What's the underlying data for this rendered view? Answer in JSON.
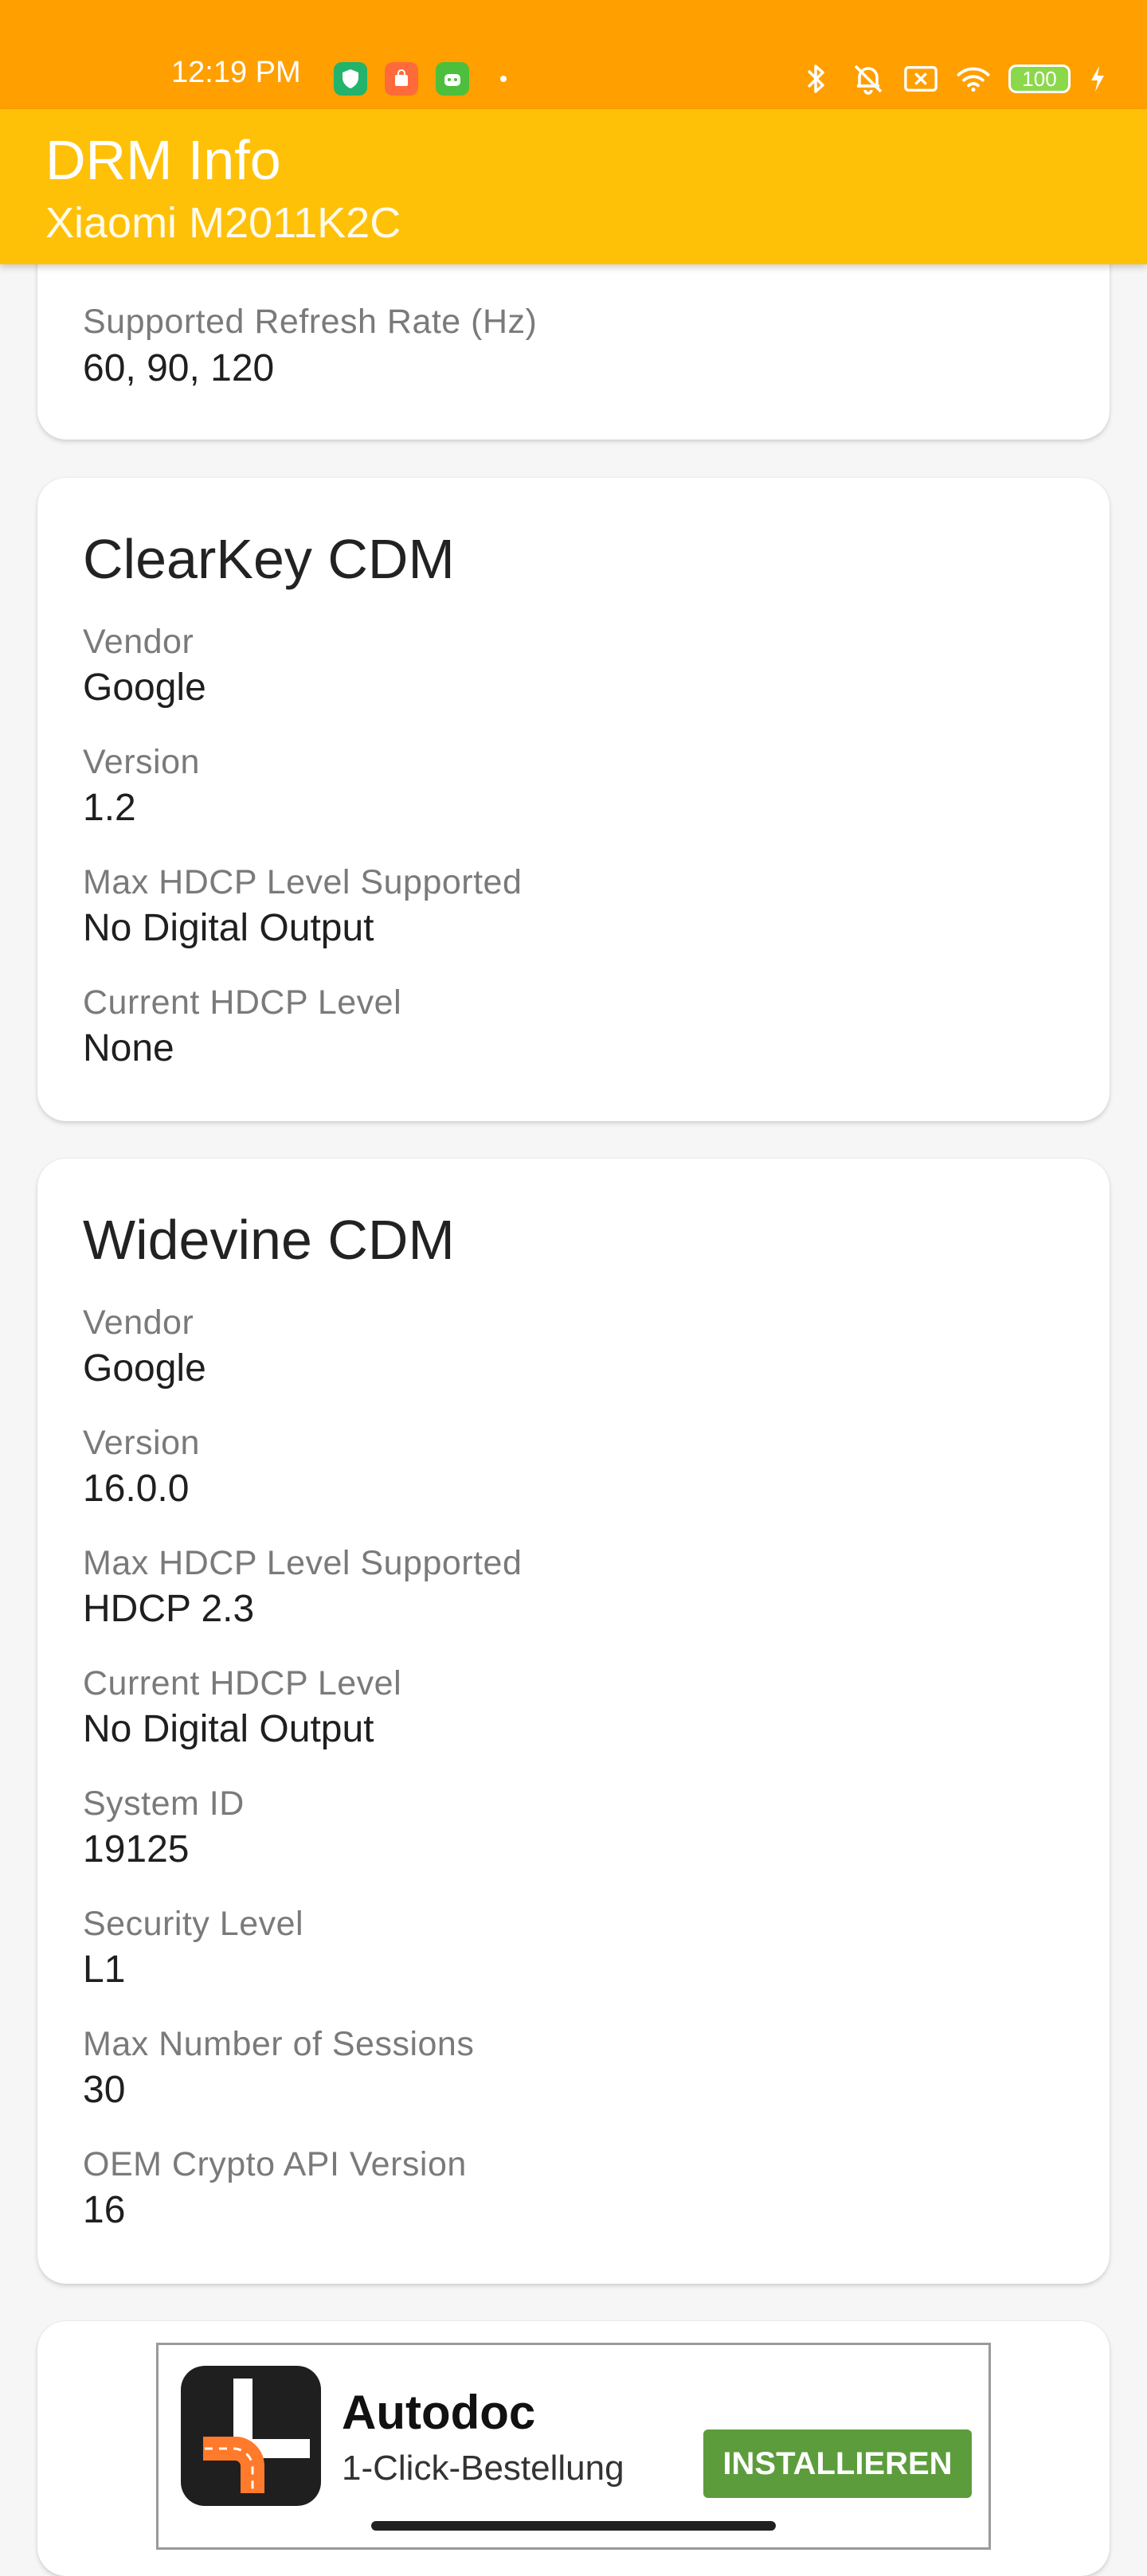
{
  "status_bar": {
    "time": "12:19 PM",
    "battery": "100"
  },
  "app_bar": {
    "title": "DRM Info",
    "subtitle": "Xiaomi M2011K2C"
  },
  "display_card": {
    "fields": [
      {
        "label": "Supported Refresh Rate (Hz)",
        "value": "60, 90, 120"
      }
    ]
  },
  "clearkey_card": {
    "title": "ClearKey CDM",
    "fields": [
      {
        "label": "Vendor",
        "value": "Google"
      },
      {
        "label": "Version",
        "value": "1.2"
      },
      {
        "label": "Max HDCP Level Supported",
        "value": "No Digital Output"
      },
      {
        "label": "Current HDCP Level",
        "value": "None"
      }
    ]
  },
  "widevine_card": {
    "title": "Widevine CDM",
    "fields": [
      {
        "label": "Vendor",
        "value": "Google"
      },
      {
        "label": "Version",
        "value": "16.0.0"
      },
      {
        "label": "Max HDCP Level Supported",
        "value": "HDCP 2.3"
      },
      {
        "label": "Current HDCP Level",
        "value": "No Digital Output"
      },
      {
        "label": "System ID",
        "value": "19125"
      },
      {
        "label": "Security Level",
        "value": "L1"
      },
      {
        "label": "Max Number of Sessions",
        "value": "30"
      },
      {
        "label": "OEM Crypto API Version",
        "value": "16"
      }
    ]
  },
  "ad": {
    "title": "Autodoc",
    "subtitle": "1-Click-Bestellung",
    "button": "INSTALLIEREN"
  },
  "colors": {
    "status_bar": "#ff9f00",
    "app_bar": "#ffc107",
    "ad_button": "#5c9c3c"
  }
}
